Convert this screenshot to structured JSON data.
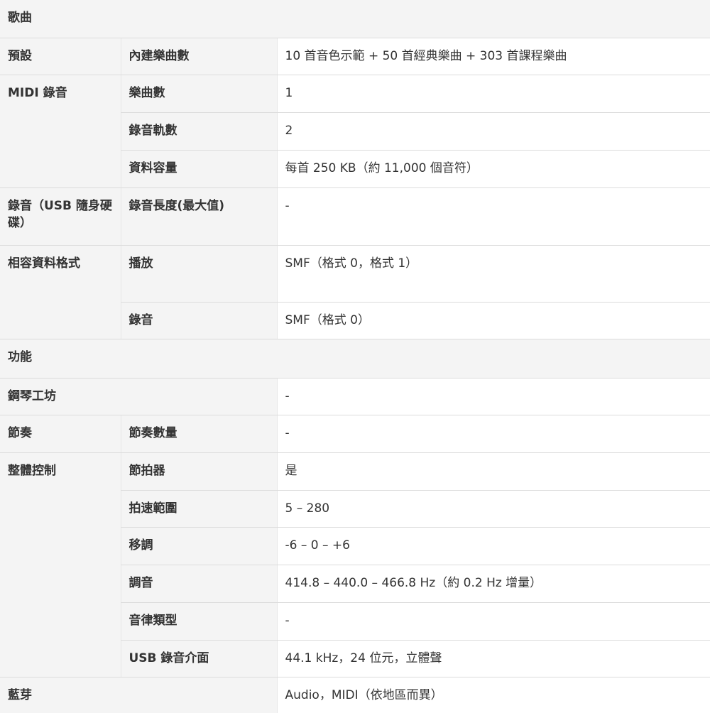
{
  "sections": {
    "songs": "歌曲",
    "functions": "功能"
  },
  "rows": {
    "preset": {
      "label": "預設",
      "sublabel": "內建樂曲數",
      "value": "10 首音色示範 + 50 首經典樂曲 + 303 首課程樂曲"
    },
    "midi_recording": {
      "label": "MIDI 錄音",
      "song_count": {
        "sublabel": "樂曲數",
        "value": "1"
      },
      "track_count": {
        "sublabel": "錄音軌數",
        "value": "2"
      },
      "data_capacity": {
        "sublabel": "資料容量",
        "value": "每首 250 KB（約 11,000 個音符）"
      }
    },
    "usb_recording": {
      "label": "錄音（USB 隨身硬碟）",
      "sublabel": "錄音長度(最大值)",
      "value": "-"
    },
    "compatible_format": {
      "label": "相容資料格式",
      "playback": {
        "sublabel": "播放",
        "value": "SMF（格式 0，格式 1）"
      },
      "recording": {
        "sublabel": "錄音",
        "value": "SMF（格式 0）"
      }
    },
    "piano_room": {
      "label": "鋼琴工坊",
      "value": "-"
    },
    "rhythm": {
      "label": "節奏",
      "sublabel": "節奏數量",
      "value": "-"
    },
    "overall_control": {
      "label": "整體控制",
      "metronome": {
        "sublabel": "節拍器",
        "value": "是"
      },
      "tempo_range": {
        "sublabel": "拍速範圍",
        "value": "5 – 280"
      },
      "transpose": {
        "sublabel": "移調",
        "value": "-6 – 0 – +6"
      },
      "tuning": {
        "sublabel": "調音",
        "value": "414.8 – 440.0 – 466.8 Hz（約 0.2 Hz 增量）"
      },
      "scale_type": {
        "sublabel": "音律類型",
        "value": "-"
      },
      "usb_audio_interface": {
        "sublabel": "USB 錄音介面",
        "value": "44.1 kHz，24 位元，立體聲"
      }
    },
    "bluetooth": {
      "label": "藍芽",
      "value": "Audio，MIDI（依地區而異）"
    }
  }
}
